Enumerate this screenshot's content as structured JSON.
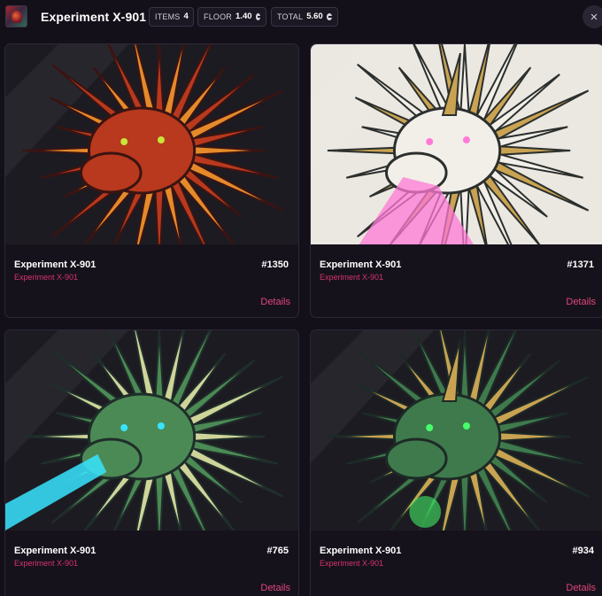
{
  "header": {
    "title": "Experiment X-901",
    "stats": [
      {
        "label": "ITEMS",
        "value": "4",
        "currency": false
      },
      {
        "label": "FLOOR",
        "value": "1.40",
        "currency": true
      },
      {
        "label": "TOTAL",
        "value": "5.60",
        "currency": true
      }
    ],
    "close_icon": "×"
  },
  "cards": [
    {
      "name": "Experiment X-901",
      "number": "#1350",
      "collection": "Experiment X-901",
      "details_label": "Details",
      "palette": {
        "bg": "#1d1b22",
        "main": "#b8391d",
        "accent": "#e58a2a",
        "dark": "#3a1412",
        "glow": "#c6e63a"
      }
    },
    {
      "name": "Experiment X-901",
      "number": "#1371",
      "collection": "Experiment X-901",
      "details_label": "Details",
      "palette": {
        "bg": "#ebe8e1",
        "main": "#f2efe9",
        "accent": "#c9a352",
        "dark": "#2b2f2d",
        "glow": "#ff7ad6"
      }
    },
    {
      "name": "Experiment X-901",
      "number": "#765",
      "collection": "Experiment X-901",
      "details_label": "Details",
      "palette": {
        "bg": "#1d1b22",
        "main": "#4c8a55",
        "accent": "#cfd49a",
        "dark": "#1f2e2a",
        "glow": "#37e4ff"
      }
    },
    {
      "name": "Experiment X-901",
      "number": "#934",
      "collection": "Experiment X-901",
      "details_label": "Details",
      "palette": {
        "bg": "#1d1b22",
        "main": "#3f7a4d",
        "accent": "#c9a352",
        "dark": "#1d2a26",
        "glow": "#45ff6a"
      }
    }
  ]
}
